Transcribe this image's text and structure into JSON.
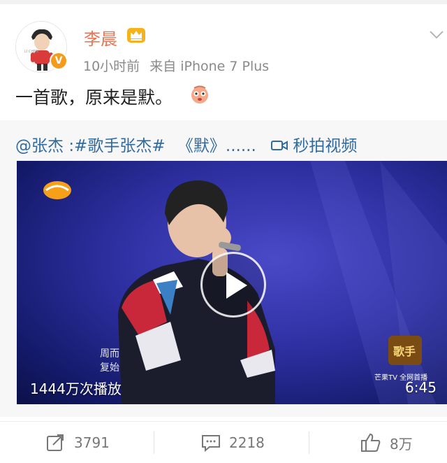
{
  "post": {
    "username": "李晨",
    "time": "10小时前",
    "source": "来自 iPhone 7 Plus",
    "text": "一首歌，原来是默。"
  },
  "repost": {
    "mention": "@张杰",
    "topic": ":#歌手张杰#",
    "title": "《默》......",
    "link_label": "秒拍视频"
  },
  "video": {
    "views": "1444万次播放",
    "duration": "6:45",
    "caption": "周而复始",
    "channel": "芒果TV 全网首播"
  },
  "actions": {
    "repost_count": "3791",
    "comment_count": "2218",
    "like_count": "8万"
  },
  "colors": {
    "username": "#eb7350",
    "link": "#2f6ba1",
    "verified_badge": "#f59b19"
  },
  "icons": [
    "crown-icon",
    "chevron-down-icon",
    "verified-badge-icon",
    "emoji-icon",
    "video-camera-icon",
    "play-icon",
    "repost-icon",
    "comment-icon",
    "like-icon"
  ]
}
